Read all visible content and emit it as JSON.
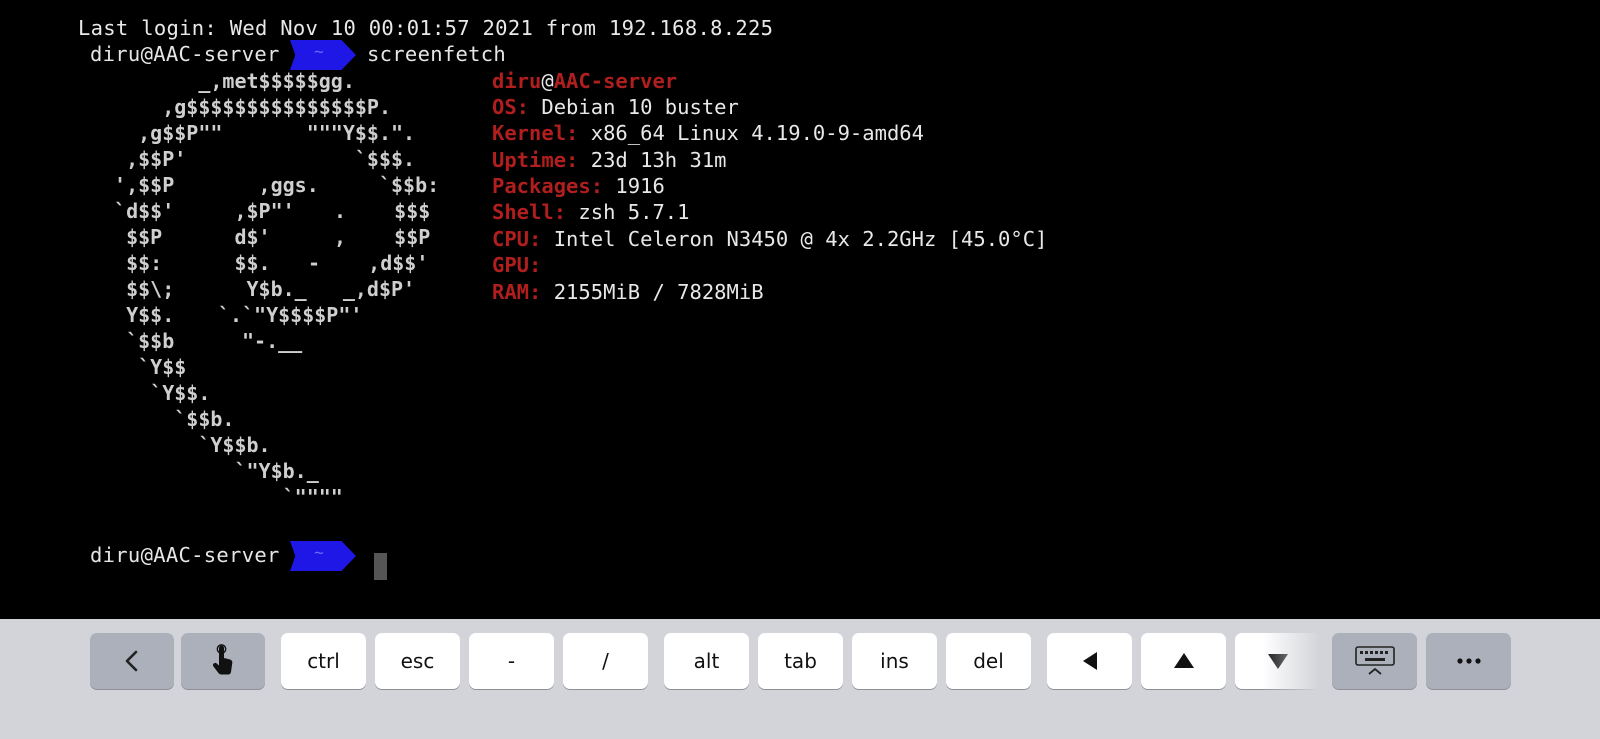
{
  "terminal": {
    "last_login": "Last login: Wed Nov 10 00:01:57 2021 from 192.168.8.225",
    "prompt_user": "diru@AAC-server",
    "prompt_dir": "~",
    "command": "screenfetch",
    "logo_lines": [
      "        _,met$$$$$gg.",
      "     ,g$$$$$$$$$$$$$$$P.",
      "   ,g$$P\"\"       \"\"\"Y$$.\".",
      "  ,$$P'              `$$$.",
      " ',$$P       ,ggs.     `$$b:",
      " `d$$'     ,$P\"'   ",
      "  $$P      d$'     ",
      "  $$:      $$.   ",
      "  $$\\;      Y$b._   _,d$P'",
      "  Y$$.    ",
      "  `$$b      ",
      "   `Y$$",
      "    `Y$$.",
      "      `$$b.",
      "        `Y$$b.",
      "           `\"Y$b._",
      "               `\"\"\"\""
    ],
    "logo_red_marks": [
      ".",
      ",",
      "-",
      "`.",
      "\"-.__"
    ],
    "logo_tail": [
      "    $$$",
      "    $$P",
      "    ,d$$'",
      "`\"Y$$$$P\"'"
    ],
    "info": {
      "user": "diru",
      "host": "AAC-server",
      "rows": [
        {
          "key": "OS:",
          "value": " Debian 10 buster"
        },
        {
          "key": "Kernel:",
          "value": " x86_64 Linux 4.19.0-9-amd64"
        },
        {
          "key": "Uptime:",
          "value": " 23d 13h 31m"
        },
        {
          "key": "Packages:",
          "value": " 1916"
        },
        {
          "key": "Shell:",
          "value": " zsh 5.7.1"
        },
        {
          "key": "CPU:",
          "value": " Intel Celeron N3450 @ 4x 2.2GHz [45.0°C]"
        },
        {
          "key": "GPU:",
          "value": ""
        },
        {
          "key": "RAM:",
          "value": " 2155MiB / 7828MiB"
        }
      ]
    }
  },
  "keybar": {
    "keys": [
      {
        "label": "",
        "icon": "chevron-left-icon"
      },
      {
        "label": "",
        "icon": "touch-hand-icon"
      },
      {
        "label": "ctrl"
      },
      {
        "label": "esc"
      },
      {
        "label": "-"
      },
      {
        "label": "/"
      },
      {
        "label": "alt"
      },
      {
        "label": "tab"
      },
      {
        "label": "ins"
      },
      {
        "label": "del"
      },
      {
        "label": "",
        "icon": "arrow-left-icon"
      },
      {
        "label": "",
        "icon": "arrow-up-icon"
      },
      {
        "label": "",
        "icon": "arrow-down-icon"
      },
      {
        "label": "",
        "icon": "keyboard-hide-icon"
      },
      {
        "label": "",
        "icon": "more-icon"
      }
    ]
  }
}
